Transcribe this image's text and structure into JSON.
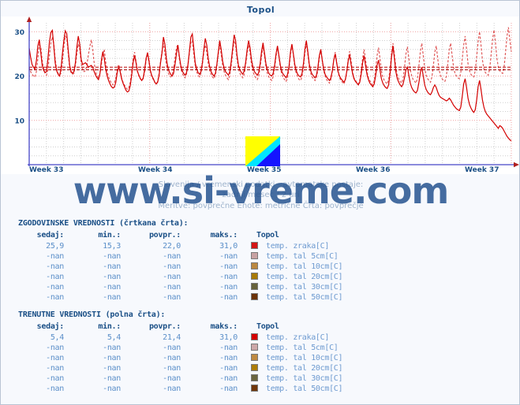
{
  "page": {
    "site_label": "www.si-vreme.com",
    "watermark": "www.si-vreme.com",
    "bg_color": "#f7f9fd",
    "accent_color": "#1a4f86"
  },
  "chart_header": {
    "title": "Topol"
  },
  "subtitle": {
    "line1": "Slovenija / vremenski podatki - avtomatske postaje:",
    "line2": "zadnji mesec / 2 uri",
    "line3": "Meritve: povprečne  Enote: metrične  Črta: povprečje"
  },
  "logo": {
    "name": "si-vreme-logo",
    "colors": [
      "#ffff00",
      "#00e5ff",
      "#1414ff"
    ]
  },
  "chart_data": {
    "type": "line",
    "title": "Topol",
    "xlabel": "",
    "ylabel": "",
    "ylim": [
      0,
      32
    ],
    "yticks": [
      10,
      20,
      30
    ],
    "ytick_labels": [
      "10",
      "20",
      "30"
    ],
    "xticks": [
      0,
      0.25,
      0.5,
      0.75,
      1.0
    ],
    "xtick_labels": [
      "Week 33",
      "Week 34",
      "Week 35",
      "Week 36",
      "Week 37"
    ],
    "grid": true,
    "legend_position": "below-table",
    "series": [
      {
        "name": "temp. zraka[C] - trenutne (polna črta)",
        "style": "solid",
        "color": "#d40000",
        "average_line": 21.4,
        "values": [
          26.3,
          24.2,
          22.6,
          22.0,
          21.5,
          23.5,
          26.8,
          28.2,
          25.4,
          22.4,
          21.3,
          20.8,
          21.0,
          24.0,
          27.6,
          29.8,
          30.3,
          27.0,
          23.0,
          21.2,
          20.4,
          20.0,
          21.5,
          25.0,
          28.0,
          30.2,
          29.6,
          26.0,
          22.5,
          21.0,
          20.6,
          21.0,
          23.0,
          26.5,
          29.0,
          27.2,
          23.8,
          22.6,
          22.8,
          23.0,
          22.6,
          22.0,
          22.2,
          22.4,
          22.0,
          21.0,
          20.2,
          19.6,
          19.2,
          20.5,
          23.5,
          25.5,
          24.0,
          21.5,
          20.0,
          19.0,
          18.2,
          17.6,
          17.3,
          17.5,
          18.6,
          20.8,
          22.0,
          21.0,
          19.4,
          18.4,
          17.6,
          16.8,
          16.4,
          16.6,
          17.8,
          20.2,
          23.0,
          24.6,
          23.0,
          21.0,
          20.2,
          19.4,
          19.0,
          19.6,
          21.5,
          24.0,
          25.3,
          23.4,
          21.2,
          20.0,
          19.4,
          18.6,
          18.2,
          18.6,
          20.2,
          23.0,
          25.2,
          28.8,
          27.2,
          24.0,
          22.0,
          21.0,
          20.4,
          20.0,
          20.6,
          22.5,
          25.0,
          27.0,
          24.5,
          22.4,
          21.2,
          20.6,
          20.2,
          20.8,
          22.6,
          25.6,
          28.8,
          29.5,
          26.4,
          23.0,
          21.6,
          20.8,
          20.4,
          21.0,
          23.0,
          26.0,
          28.5,
          27.0,
          24.0,
          22.2,
          21.0,
          20.4,
          20.0,
          20.6,
          22.6,
          25.4,
          28.0,
          26.0,
          23.4,
          21.8,
          21.0,
          20.6,
          20.2,
          21.0,
          23.4,
          26.4,
          29.3,
          28.0,
          24.6,
          22.4,
          21.4,
          20.8,
          20.4,
          21.2,
          23.2,
          26.0,
          28.0,
          26.4,
          23.6,
          22.0,
          21.0,
          20.6,
          20.2,
          20.8,
          22.8,
          25.6,
          27.5,
          25.2,
          22.8,
          21.4,
          20.6,
          20.2,
          20.0,
          20.6,
          22.4,
          25.0,
          26.8,
          24.6,
          22.4,
          21.0,
          20.4,
          20.0,
          19.6,
          20.4,
          22.2,
          25.4,
          27.2,
          25.0,
          22.6,
          21.2,
          20.4,
          20.0,
          19.8,
          20.6,
          22.8,
          26.0,
          28.0,
          25.6,
          22.8,
          21.2,
          20.4,
          20.0,
          19.6,
          20.2,
          22.0,
          24.6,
          26.0,
          23.6,
          21.6,
          20.4,
          19.8,
          19.4,
          19.0,
          19.6,
          21.2,
          23.6,
          25.0,
          23.0,
          21.0,
          20.0,
          19.4,
          19.0,
          18.6,
          19.2,
          21.0,
          23.4,
          24.8,
          22.6,
          20.6,
          19.4,
          18.8,
          18.4,
          18.0,
          18.6,
          20.4,
          23.0,
          24.6,
          22.4,
          20.4,
          19.2,
          18.4,
          18.0,
          17.6,
          18.2,
          20.0,
          22.4,
          23.6,
          21.4,
          19.4,
          18.4,
          17.8,
          17.4,
          17.2,
          18.0,
          20.6,
          24.2,
          26.8,
          24.0,
          21.0,
          19.4,
          18.6,
          18.0,
          17.6,
          18.2,
          19.6,
          21.4,
          22.0,
          20.2,
          18.4,
          17.4,
          16.8,
          16.4,
          16.2,
          16.8,
          18.6,
          20.8,
          22.0,
          20.0,
          18.0,
          17.0,
          16.4,
          16.0,
          15.8,
          16.4,
          17.4,
          18.0,
          17.4,
          16.4,
          15.6,
          15.2,
          15.0,
          14.8,
          14.6,
          14.4,
          14.6,
          15.0,
          14.6,
          14.0,
          13.4,
          13.0,
          12.6,
          12.4,
          12.2,
          13.0,
          15.4,
          18.2,
          19.4,
          17.4,
          15.0,
          13.6,
          12.8,
          12.2,
          11.8,
          12.4,
          14.6,
          17.6,
          19.0,
          17.0,
          14.6,
          13.0,
          12.0,
          11.4,
          11.0,
          10.6,
          10.2,
          9.8,
          9.4,
          9.0,
          8.6,
          8.2,
          8.8,
          8.6,
          8.2,
          7.6,
          7.0,
          6.4,
          6.0,
          5.6,
          5.4
        ]
      },
      {
        "name": "temp. zraka[C] - zgodovinske (črtkana črta)",
        "style": "dashed",
        "color": "#e05a5a",
        "average_line": 22.0,
        "values": [
          22.0,
          21.0,
          20.4,
          20.0,
          19.8,
          21.0,
          24.0,
          27.0,
          26.6,
          23.6,
          21.6,
          20.6,
          20.2,
          21.6,
          24.6,
          27.4,
          28.8,
          27.4,
          23.8,
          21.6,
          20.6,
          20.2,
          20.6,
          23.0,
          26.6,
          29.0,
          28.6,
          25.2,
          22.0,
          20.8,
          20.4,
          20.6,
          22.2,
          25.0,
          27.2,
          26.2,
          23.0,
          21.4,
          21.0,
          21.2,
          22.6,
          24.8,
          26.6,
          28.2,
          26.0,
          23.0,
          21.0,
          20.0,
          19.6,
          20.4,
          22.6,
          25.0,
          26.0,
          23.2,
          21.0,
          19.8,
          19.0,
          18.4,
          18.0,
          18.4,
          19.6,
          21.6,
          22.6,
          21.4,
          19.6,
          18.6,
          18.0,
          17.4,
          17.0,
          17.4,
          18.6,
          21.0,
          24.0,
          25.4,
          23.4,
          21.2,
          20.0,
          19.4,
          19.0,
          19.4,
          21.0,
          23.6,
          25.0,
          23.0,
          21.0,
          19.8,
          19.2,
          18.6,
          18.2,
          18.8,
          20.6,
          23.4,
          25.6,
          27.4,
          25.2,
          22.6,
          21.0,
          20.2,
          19.8,
          20.2,
          21.6,
          24.0,
          26.4,
          27.0,
          24.0,
          21.8,
          20.6,
          20.0,
          19.6,
          20.4,
          22.4,
          25.4,
          27.6,
          28.0,
          25.0,
          22.4,
          21.0,
          20.2,
          19.8,
          20.6,
          22.6,
          25.4,
          27.0,
          25.4,
          22.8,
          21.2,
          20.4,
          19.8,
          19.4,
          20.2,
          22.2,
          25.0,
          27.0,
          25.0,
          22.4,
          21.0,
          20.2,
          19.6,
          19.2,
          20.2,
          22.4,
          25.4,
          28.0,
          27.0,
          23.8,
          21.6,
          20.6,
          20.0,
          19.6,
          20.4,
          22.6,
          25.2,
          27.0,
          25.2,
          22.6,
          21.0,
          20.2,
          19.6,
          19.2,
          20.0,
          22.0,
          24.6,
          26.6,
          24.6,
          22.0,
          20.6,
          19.8,
          19.4,
          19.0,
          19.8,
          21.6,
          24.4,
          26.4,
          24.4,
          21.8,
          20.4,
          19.6,
          19.2,
          18.8,
          19.6,
          21.6,
          24.8,
          27.0,
          24.8,
          22.0,
          20.6,
          19.8,
          19.2,
          19.0,
          19.8,
          22.0,
          25.2,
          27.4,
          25.0,
          22.2,
          20.6,
          19.8,
          19.4,
          19.0,
          19.6,
          21.4,
          24.0,
          26.0,
          23.8,
          21.2,
          20.0,
          19.2,
          18.8,
          18.4,
          19.2,
          21.0,
          23.6,
          25.4,
          23.2,
          20.8,
          19.6,
          19.0,
          18.6,
          18.2,
          19.0,
          21.0,
          23.8,
          25.6,
          23.4,
          21.0,
          19.6,
          19.0,
          18.6,
          18.2,
          19.0,
          21.2,
          24.0,
          26.0,
          23.8,
          21.0,
          19.6,
          19.0,
          18.4,
          18.0,
          19.0,
          21.4,
          24.6,
          26.4,
          24.0,
          21.2,
          19.8,
          19.0,
          18.6,
          18.2,
          19.2,
          21.6,
          25.0,
          27.4,
          25.0,
          22.0,
          20.2,
          19.4,
          18.8,
          18.4,
          19.4,
          22.0,
          25.0,
          26.6,
          24.0,
          21.4,
          20.0,
          19.2,
          18.8,
          18.4,
          19.6,
          22.4,
          25.6,
          27.4,
          24.6,
          21.8,
          20.2,
          19.4,
          19.0,
          18.6,
          19.8,
          22.4,
          25.4,
          26.8,
          24.0,
          21.4,
          20.0,
          19.4,
          19.0,
          18.8,
          20.0,
          22.8,
          26.0,
          27.4,
          24.6,
          22.0,
          20.6,
          20.0,
          19.6,
          19.4,
          20.8,
          23.8,
          27.0,
          29.0,
          26.0,
          22.8,
          21.2,
          20.4,
          20.0,
          19.8,
          21.2,
          24.4,
          27.8,
          30.0,
          27.0,
          23.6,
          21.6,
          20.8,
          20.4,
          20.2,
          21.6,
          24.8,
          28.2,
          30.4,
          27.6,
          24.0,
          22.0,
          21.2,
          20.8,
          20.6,
          22.0,
          25.4,
          29.0,
          31.0,
          28.0,
          25.5
        ]
      }
    ]
  },
  "tables": [
    {
      "id": "historical",
      "section_title": "ZGODOVINSKE VREDNOSTI (črtkana črta):",
      "headers": [
        "sedaj:",
        "min.:",
        "povpr.:",
        "maks.:",
        "Topol"
      ],
      "rows": [
        {
          "sedaj": "25,9",
          "min": "15,3",
          "povpr": "22,0",
          "maks": "31,0",
          "color": "#d41616",
          "label": "temp. zraka[C]"
        },
        {
          "sedaj": "-nan",
          "min": "-nan",
          "povpr": "-nan",
          "maks": "-nan",
          "color": "#c8a2a2",
          "label": "temp. tal  5cm[C]"
        },
        {
          "sedaj": "-nan",
          "min": "-nan",
          "povpr": "-nan",
          "maks": "-nan",
          "color": "#bb8840",
          "label": "temp. tal 10cm[C]"
        },
        {
          "sedaj": "-nan",
          "min": "-nan",
          "povpr": "-nan",
          "maks": "-nan",
          "color": "#a87a06",
          "label": "temp. tal 20cm[C]"
        },
        {
          "sedaj": "-nan",
          "min": "-nan",
          "povpr": "-nan",
          "maks": "-nan",
          "color": "#68633c",
          "label": "temp. tal 30cm[C]"
        },
        {
          "sedaj": "-nan",
          "min": "-nan",
          "povpr": "-nan",
          "maks": "-nan",
          "color": "#6b3308",
          "label": "temp. tal 50cm[C]"
        }
      ]
    },
    {
      "id": "current",
      "section_title": "TRENUTNE VREDNOSTI (polna črta):",
      "headers": [
        "sedaj:",
        "min.:",
        "povpr.:",
        "maks.:",
        "Topol"
      ],
      "rows": [
        {
          "sedaj": "5,4",
          "min": "5,4",
          "povpr": "21,4",
          "maks": "31,0",
          "color": "#d40000",
          "label": "temp. zraka[C]"
        },
        {
          "sedaj": "-nan",
          "min": "-nan",
          "povpr": "-nan",
          "maks": "-nan",
          "color": "#cda8a8",
          "label": "temp. tal  5cm[C]"
        },
        {
          "sedaj": "-nan",
          "min": "-nan",
          "povpr": "-nan",
          "maks": "-nan",
          "color": "#bf8a42",
          "label": "temp. tal 10cm[C]"
        },
        {
          "sedaj": "-nan",
          "min": "-nan",
          "povpr": "-nan",
          "maks": "-nan",
          "color": "#ad7d08",
          "label": "temp. tal 20cm[C]"
        },
        {
          "sedaj": "-nan",
          "min": "-nan",
          "povpr": "-nan",
          "maks": "-nan",
          "color": "#6b663f",
          "label": "temp. tal 30cm[C]"
        },
        {
          "sedaj": "-nan",
          "min": "-nan",
          "povpr": "-nan",
          "maks": "-nan",
          "color": "#70360a",
          "label": "temp. tal 50cm[C]"
        }
      ]
    }
  ]
}
